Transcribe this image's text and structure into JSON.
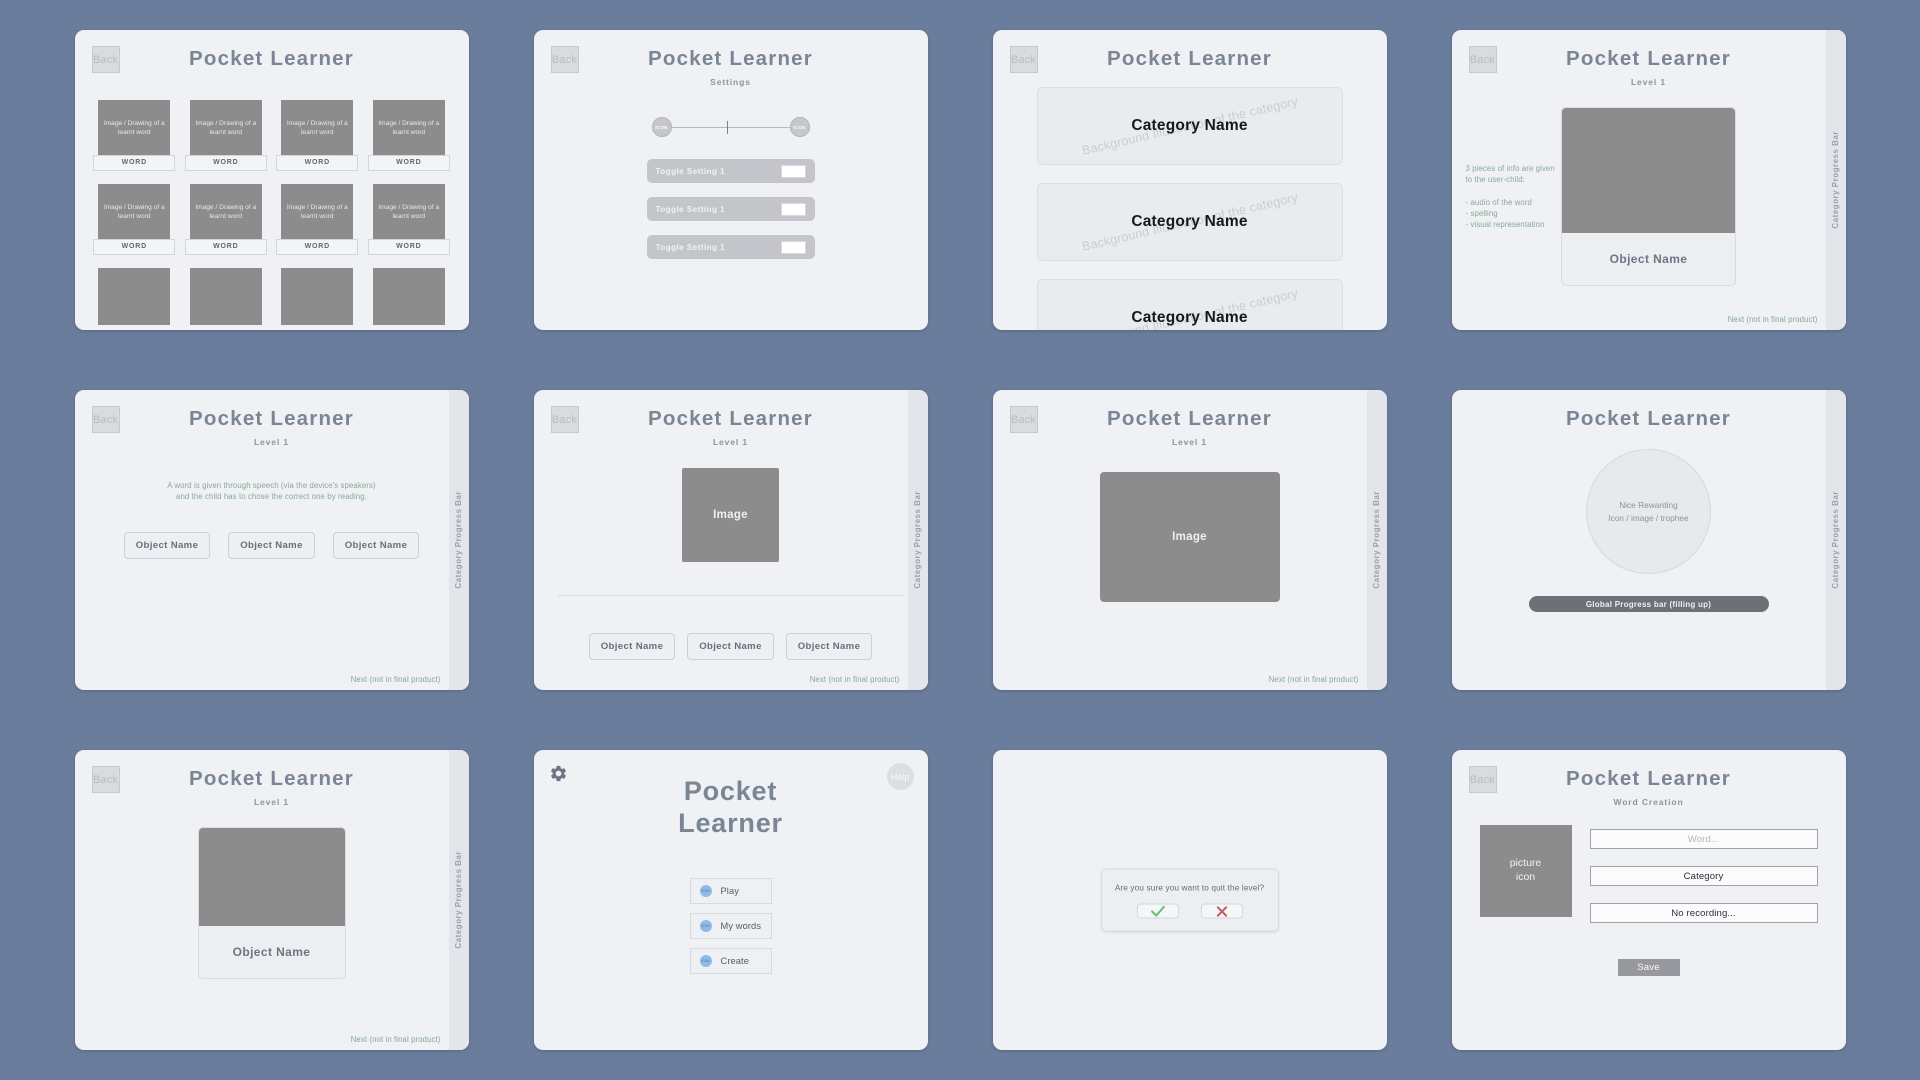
{
  "app": {
    "title": "Pocket Learner",
    "back_label": "Back",
    "help_label": "Help",
    "progress_rail_label": "Category Progress Bar",
    "next_note": "Next (not in final product)"
  },
  "colors": {
    "canvas_background": "#6a7d9c",
    "screen_background": "#eff1f5",
    "placeholder_gray": "#8c8c8c",
    "title_gray": "#7b8694",
    "annotation_green": "#8aa994",
    "accent_blue": "#8ebbe8",
    "confirm_green": "#6fbf73",
    "cancel_red": "#c75a5a"
  },
  "screens": [
    {
      "id": "my-words-grid",
      "subtitle": "",
      "word_cards": [
        {
          "thumb": "Image / Drawing of a learnt word",
          "label": "WORD"
        },
        {
          "thumb": "Image / Drawing of a learnt word",
          "label": "WORD"
        },
        {
          "thumb": "Image / Drawing of a learnt word",
          "label": "WORD"
        },
        {
          "thumb": "Image / Drawing of a learnt word",
          "label": "WORD"
        },
        {
          "thumb": "Image / Drawing of a learnt word",
          "label": "WORD"
        },
        {
          "thumb": "Image / Drawing of a learnt word",
          "label": "WORD"
        },
        {
          "thumb": "Image / Drawing of a learnt word",
          "label": "WORD"
        },
        {
          "thumb": "Image / Drawing of a learnt word",
          "label": "WORD"
        }
      ]
    },
    {
      "id": "settings",
      "subtitle": "Settings",
      "slider": {
        "left_icon": "ICON",
        "right_icon": "ICON",
        "value_percent": 47
      },
      "toggles": [
        {
          "label": "Toggle Setting 1"
        },
        {
          "label": "Toggle Setting 1"
        },
        {
          "label": "Toggle Setting 1"
        }
      ]
    },
    {
      "id": "category-select",
      "subtitle": "",
      "categories": [
        {
          "name": "Category Name",
          "background_note": "Background Illustration of the category"
        },
        {
          "name": "Category Name",
          "background_note": "Background Illustration of the category"
        },
        {
          "name": "Category Name",
          "background_note": "Background Illustration of the category"
        }
      ]
    },
    {
      "id": "level1-learn-object",
      "subtitle": "Level 1",
      "annotation": "3 pieces of info are given\nto the user-child:\n\n - audio of the word\n- spelling\n- visual representation",
      "object_name": "Object Name"
    },
    {
      "id": "level1-listen-choose",
      "subtitle": "Level 1",
      "annotation": "A word is given through speech (via the device's speakers)\nand the child has to chose the correct one by reading.",
      "options": [
        "Object Name",
        "Object Name",
        "Object Name"
      ]
    },
    {
      "id": "level1-image-choose",
      "subtitle": "Level 1",
      "image_label": "Image",
      "options": [
        "Object Name",
        "Object Name",
        "Object Name"
      ]
    },
    {
      "id": "level1-image-only",
      "subtitle": "Level 1",
      "image_label": "Image"
    },
    {
      "id": "reward",
      "subtitle": "",
      "reward_text": "Nice Rewarding\nIcon / image / trophee",
      "global_progress_label": "Global Progress bar (filling up)"
    },
    {
      "id": "level1-object-card",
      "subtitle": "Level 1",
      "object_name": "Object Name"
    },
    {
      "id": "home",
      "title_line1": "Pocket",
      "title_line2": "Learner",
      "gear_icon": "gear-icon",
      "help_label": "Help",
      "menu": [
        {
          "icon": "ICON",
          "label": "Play"
        },
        {
          "icon": "ICON",
          "label": "My words"
        },
        {
          "icon": "ICON",
          "label": "Create"
        }
      ]
    },
    {
      "id": "quit-dialog",
      "dialog": {
        "message": "Are you sure you want to quit the level?",
        "confirm_icon": "checkmark-icon",
        "cancel_icon": "cross-icon"
      }
    },
    {
      "id": "word-creation",
      "subtitle": "Word Creation",
      "picture_placeholder": "picture\nicon",
      "fields": [
        {
          "value": "Word...",
          "is_placeholder": true
        },
        {
          "value": "Category",
          "is_placeholder": false
        },
        {
          "value": "No recording...",
          "is_placeholder": false
        }
      ],
      "save_label": "Save"
    }
  ]
}
